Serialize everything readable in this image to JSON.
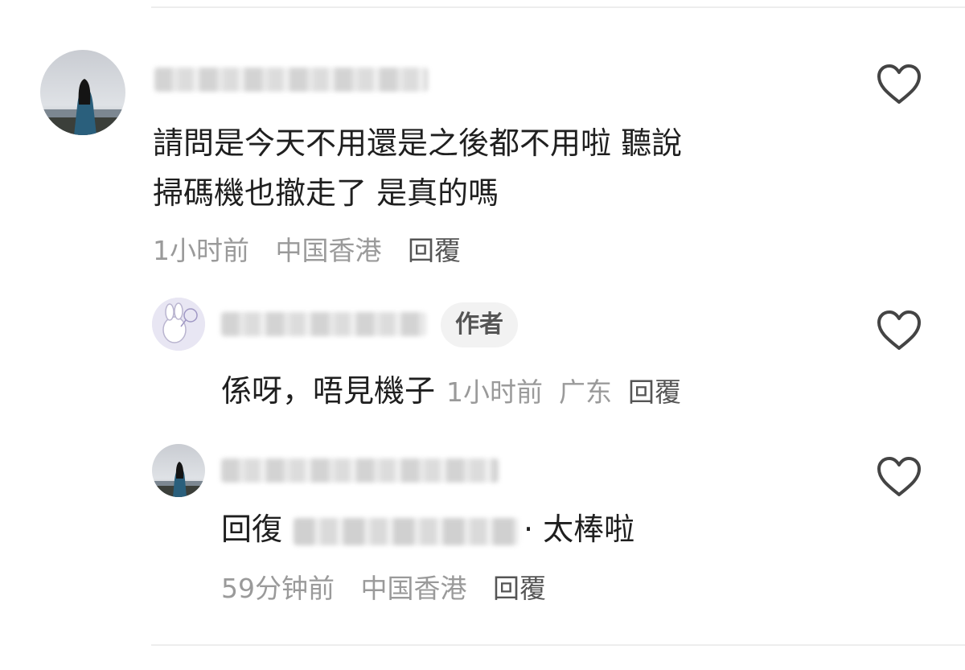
{
  "comments": [
    {
      "text_lines": [
        "請問是今天不用還是之後都不用啦 聽說",
        "掃碼機也撤走了 是真的嗎"
      ],
      "time": "1小时前",
      "location": "中国香港",
      "reply_label": "回覆"
    }
  ],
  "replies": [
    {
      "badge": "作者",
      "text": "係呀，唔見機子",
      "time": "1小时前",
      "location": "广东",
      "reply_label": "回覆"
    },
    {
      "prefix": "回復",
      "text": "· 太棒啦",
      "time": "59分钟前",
      "location": "中国香港",
      "reply_label": "回覆"
    }
  ],
  "icons": {
    "like": "heart-outline-icon"
  },
  "colors": {
    "meta_text": "#9a9a9a",
    "badge_bg": "#f2f2f2",
    "icon_stroke": "#444444"
  }
}
